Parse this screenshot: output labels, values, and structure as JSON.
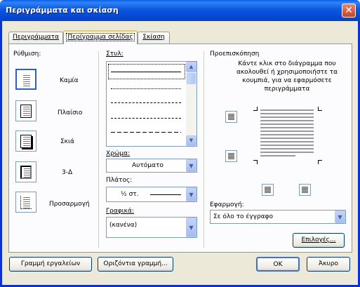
{
  "window": {
    "title": "Περιγράμματα και σκίαση",
    "close_label": "✕"
  },
  "tabs": [
    {
      "label": "Περιγράμματα"
    },
    {
      "label": "Περίγραμμα σελίδας"
    },
    {
      "label": "Σκίαση"
    }
  ],
  "setting": {
    "heading": "Ρύθμιση:",
    "options": [
      {
        "label": "Καμία",
        "icon": "none-border-icon"
      },
      {
        "label": "Πλαίσιο",
        "icon": "box-border-icon"
      },
      {
        "label": "Σκιά",
        "icon": "shadow-border-icon"
      },
      {
        "label": "3-Δ",
        "icon": "3d-border-icon"
      },
      {
        "label": "Προσαρμογή",
        "icon": "custom-border-icon"
      }
    ]
  },
  "style": {
    "heading": "Στυλ:"
  },
  "color": {
    "heading": "Χρώμα:",
    "value": "Αυτόματο"
  },
  "width": {
    "heading": "Πλάτος:",
    "value": "½ στ."
  },
  "art": {
    "heading": "Γραφικά:",
    "value": "(κανένα)"
  },
  "preview": {
    "heading": "Προεπισκόπηση",
    "instructions": "Κάντε κλικ στο διάγραμμα που ακολουθεί ή χρησιμοποιήστε τα κουμπιά, για να εφαρμόσετε περιγράμματα"
  },
  "apply_to": {
    "heading": "Εφαρμογή:",
    "value": "Σε όλο το έγγραφο"
  },
  "buttons": {
    "options": "Επιλογές...",
    "toolbar": "Γραμμή εργαλείων",
    "horizontal_line": "Οριζόντια γραμμή...",
    "ok": "OK",
    "cancel": "Άκυρο"
  },
  "colors": {
    "title_bar": "#0548d4",
    "dialog_bg": "#ece9d8",
    "tab_highlight": "#ffc83c"
  }
}
